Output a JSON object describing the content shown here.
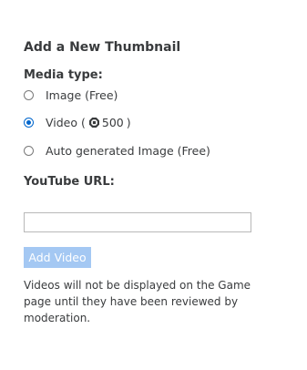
{
  "form": {
    "title": "Add a New Thumbnail",
    "media_type_label": "Media type:",
    "options": [
      {
        "label": "Image (Free)",
        "selected": false
      },
      {
        "label_prefix": "Video (",
        "price": "500",
        "label_suffix": ")",
        "selected": true,
        "icon": "robux-icon"
      },
      {
        "label": "Auto generated Image (Free)",
        "selected": false
      }
    ],
    "youtube_label": "YouTube URL:",
    "youtube_value": "",
    "youtube_placeholder": "",
    "add_button_label": "Add Video",
    "note": "Videos will not be displayed on the Game page until they have been reviewed by moderation."
  },
  "colors": {
    "accent": "#0066cc",
    "button_disabled": "#a4c8f3",
    "text": "#393b3d"
  }
}
